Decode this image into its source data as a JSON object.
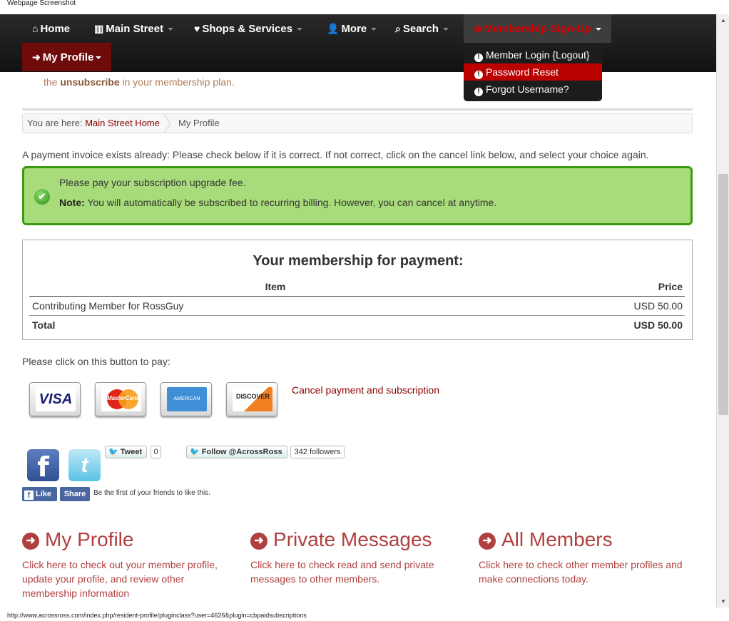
{
  "window_title": "Webpage Screenshot",
  "nav": {
    "home": "Home",
    "main_street": "Main Street",
    "shops": "Shops & Services",
    "more": "More",
    "search": "Search",
    "membership": "Membership Sign-Up",
    "my_profile": "My Profile"
  },
  "dropdown": {
    "items": [
      "Member Login {Logout}",
      "Password Reset",
      "Forgot Username?"
    ],
    "active": "Password Reset"
  },
  "partial": {
    "before": "the ",
    "link": "unsubscribe",
    "after": " in your membership plan."
  },
  "breadcrumb": {
    "prefix": "You are here:",
    "home": "Main Street Home",
    "current": "My Profile"
  },
  "invoice_note": "A payment invoice exists already: Please check below if it is correct. If not correct, click on the cancel link below, and select your choice again.",
  "success": {
    "line1": "Please pay your subscription upgrade fee.",
    "note_label": "Note:",
    "note_text": " You will automatically be subscribed to recurring billing. However, you can cancel at anytime."
  },
  "payment": {
    "title": "Your membership for payment:",
    "col_item": "Item",
    "col_price": "Price",
    "item_name": "Contributing Member for RossGuy",
    "item_price": "USD 50.00",
    "total_label": "Total",
    "total_price": "USD 50.00"
  },
  "pay_prompt": "Please click on this button to pay:",
  "cards": {
    "visa": "VISA",
    "mastercard": "MasterCard",
    "amex": "AMERICAN EXPRESS",
    "discover": "DISCOVER"
  },
  "cancel_link": "Cancel payment and subscription",
  "social": {
    "tweet": "Tweet",
    "tweet_count": "0",
    "follow": "Follow @AcrossRoss",
    "followers": "342 followers",
    "like": "Like",
    "share": "Share",
    "like_note": "Be the first of your friends to like this."
  },
  "blocks": [
    {
      "title": "My Profile",
      "text": "Click here to check out your member profile, update your profile, and review other membership information"
    },
    {
      "title": "Private Messages",
      "text": "Click here to check read and send private messages to other members."
    },
    {
      "title": "All Members",
      "text": "Click here to check other member profiles and make connections today."
    }
  ],
  "status_url": "http://www.acrossross.com/index.php/resident-profile/pluginclass?user=4626&plugin=cbpaidsubscriptions",
  "colors": {
    "accent": "#b0403f",
    "nav_bg": "#1a1a1a",
    "success_bg": "#a8dc7a",
    "success_border": "#3a9b12",
    "link": "#8b0000"
  }
}
